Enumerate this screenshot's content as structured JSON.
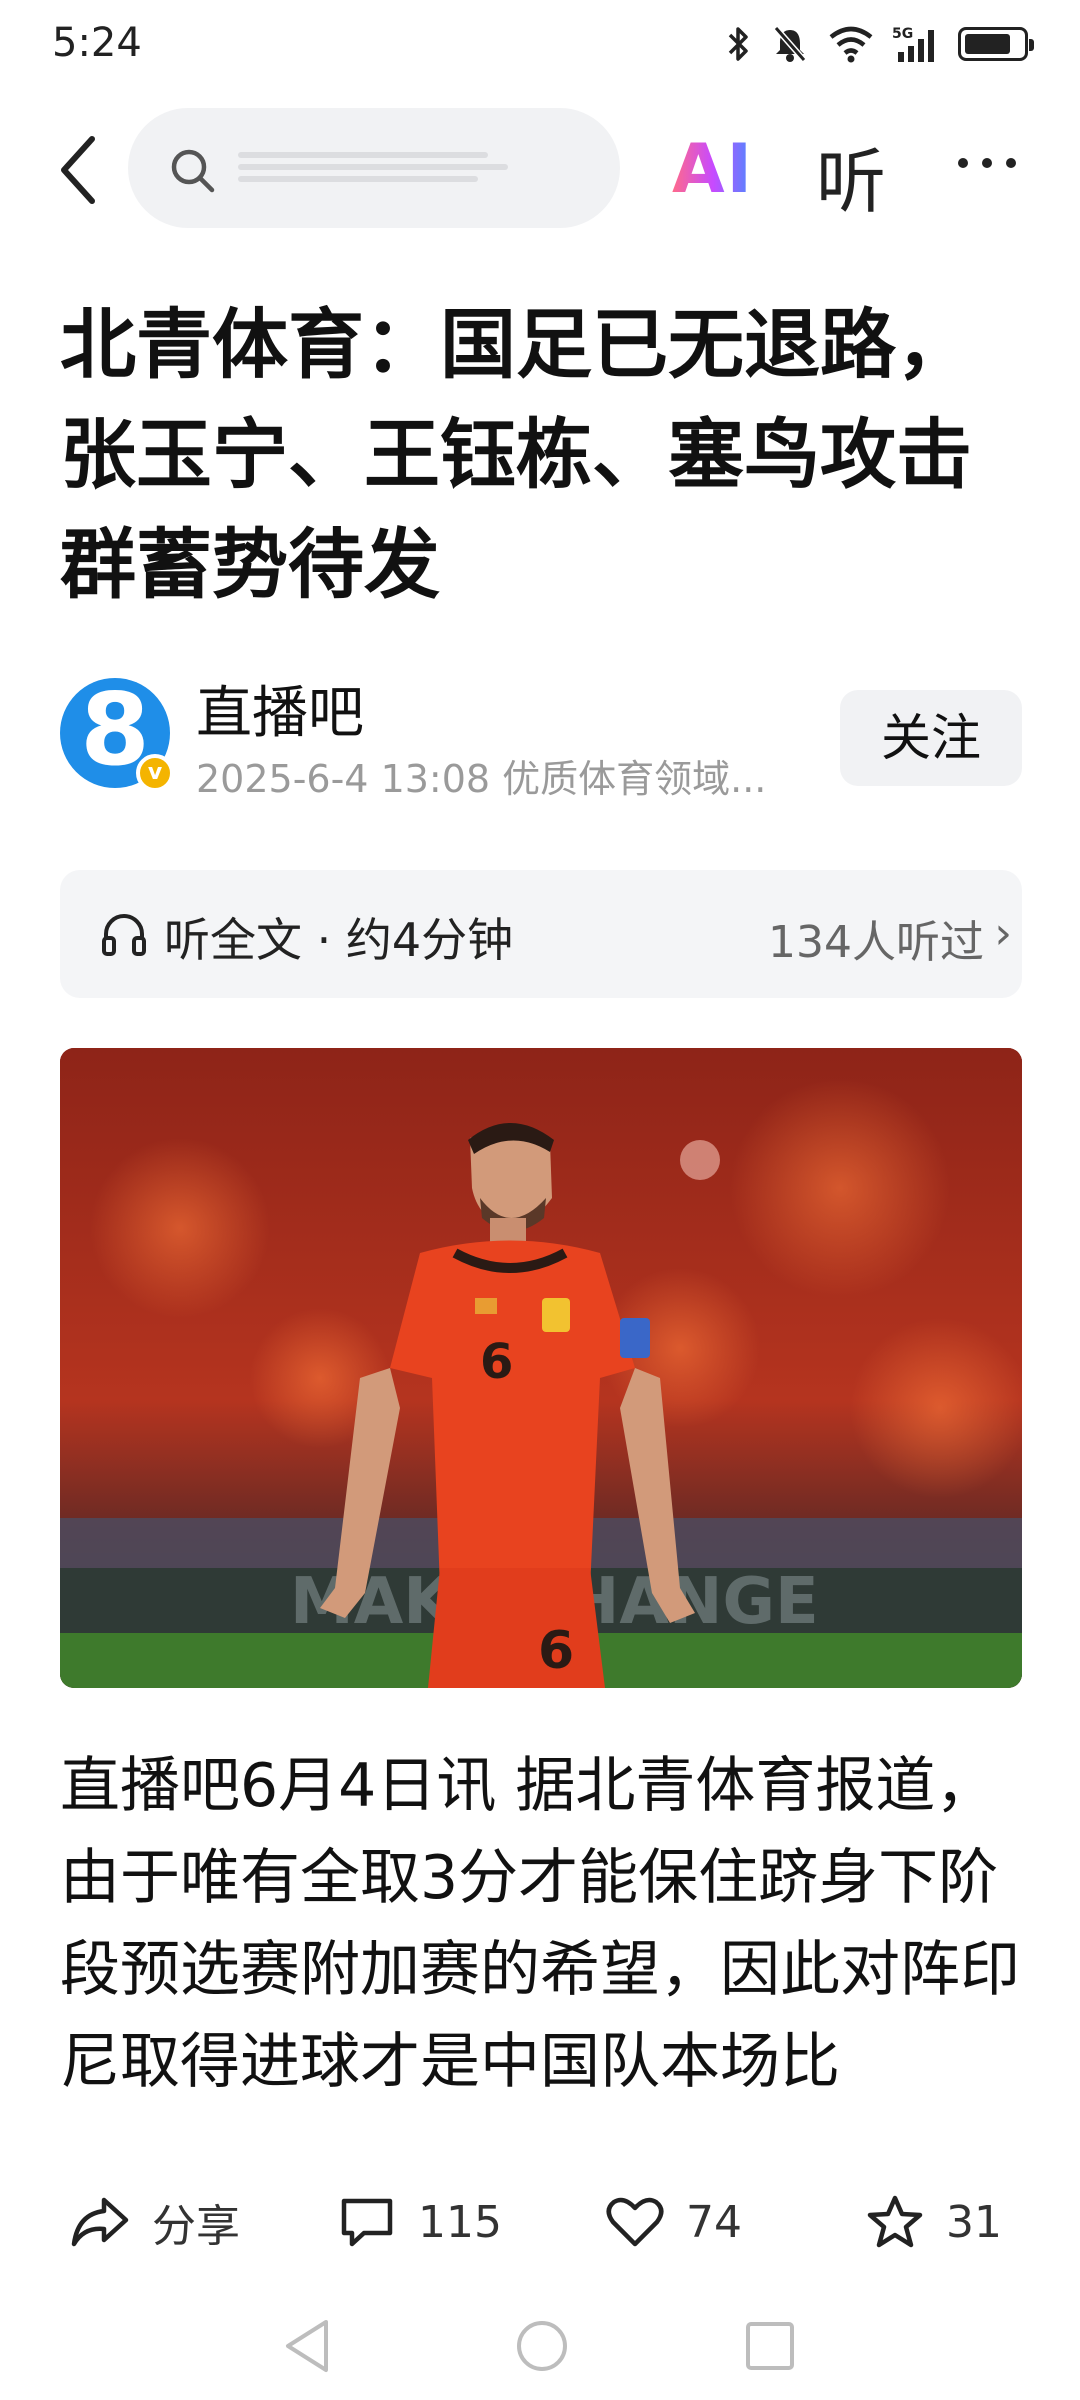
{
  "status_bar": {
    "time": "5:24",
    "icons": [
      "bluetooth-icon",
      "mute-icon",
      "wifi-icon",
      "5g-signal-icon",
      "battery-icon"
    ],
    "network_label": "5G",
    "battery_level": 0.8
  },
  "top_nav": {
    "ai_label": "AI",
    "listen_label": "听"
  },
  "article": {
    "title": "北青体育：国足已无退路，张玉宁、王钰栋、塞鸟攻击群蓄势待发",
    "author": {
      "name": "直播吧",
      "avatar_glyph": "8",
      "verified_mark": "v",
      "meta": "2025-6-4  13:08  优质体育领域..."
    },
    "follow_label": "关注",
    "listen": {
      "label": "听全文 · 约4分钟",
      "count": "134人听过",
      "chevron": "›"
    },
    "photo_jersey_number": "6",
    "body": "直播吧6月4日讯 据北青体育报道，由于唯有全取3分才能保住跻身下阶段预选赛附加赛的希望，因此对阵印尼取得进球才是中国队本场比"
  },
  "actions": {
    "share": "分享",
    "comments": "115",
    "likes": "74",
    "favorites": "31"
  },
  "colors": {
    "accent_blue": "#1f8ee8",
    "badge_gold": "#f4b400",
    "jersey_red": "#e8431f"
  }
}
